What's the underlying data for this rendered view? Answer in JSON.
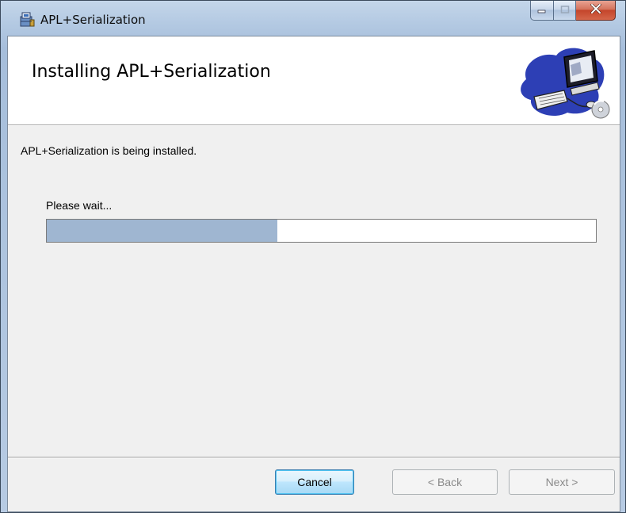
{
  "window": {
    "title": "APL+Serialization",
    "icons": {
      "app": "installer-box-icon",
      "minimize": "minimize-icon",
      "maximize": "maximize-icon",
      "close": "close-icon"
    }
  },
  "banner": {
    "title": "Installing APL+Serialization",
    "image": "computer-setup-illustration"
  },
  "content": {
    "status_text": "APL+Serialization is being installed.",
    "wait_label": "Please wait...",
    "progress_fraction": 0.42
  },
  "buttons": {
    "cancel": "Cancel",
    "back": "< Back",
    "next": "Next >"
  },
  "colors": {
    "progress_fill": "#9fb6d1",
    "close_button": "#c4452b"
  }
}
